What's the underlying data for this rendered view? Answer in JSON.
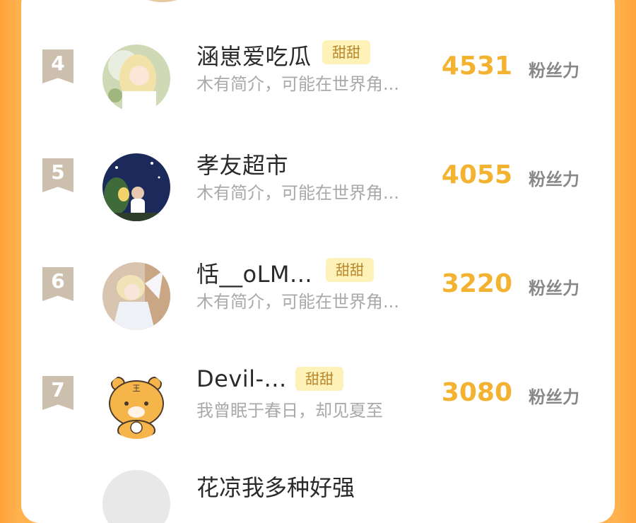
{
  "rows": [
    {
      "rank": "4",
      "name": "涵崽爱吃瓜",
      "badge": "甜甜",
      "desc": "木有简介，可能在世界角...",
      "score": "4531",
      "unit": "粉丝力",
      "avatar": "avatar-girl-blonde"
    },
    {
      "rank": "5",
      "name": "孝友超市",
      "badge": "",
      "desc": "木有简介，可能在世界角...",
      "score": "4055",
      "unit": "粉丝力",
      "avatar": "avatar-night-scene"
    },
    {
      "rank": "6",
      "name": "恬__oLM...",
      "badge": "甜甜",
      "desc": "木有简介，可能在世界角...",
      "score": "3220",
      "unit": "粉丝力",
      "avatar": "avatar-angel"
    },
    {
      "rank": "7",
      "name": "Devil-...",
      "badge": "甜甜",
      "desc": "我曾眠于春日，却见夏至",
      "score": "3080",
      "unit": "粉丝力",
      "avatar": "avatar-tiger"
    }
  ],
  "partial": {
    "bottom_name": "花凉我多种好强"
  },
  "colors": {
    "score": "#f3b331",
    "badge_bg": "#fff2b8",
    "rank_bg": "#cdbfae"
  }
}
